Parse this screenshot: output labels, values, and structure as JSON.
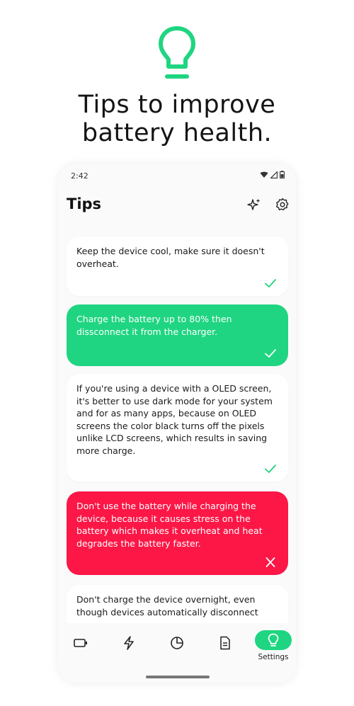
{
  "hero": {
    "icon": "lightbulb-icon",
    "headline_line1": "Tips to improve",
    "headline_line2": "battery health.",
    "accent": "#1fd581"
  },
  "status_bar": {
    "time": "2:42",
    "icons": [
      "wifi-icon",
      "signal-icon",
      "battery-icon"
    ]
  },
  "app_bar": {
    "title": "Tips",
    "actions": [
      "sparkle-icon",
      "settings-icon"
    ]
  },
  "tips": [
    {
      "text": "Keep the device cool, make sure it doesn't overheat.",
      "style": "plain",
      "mark": "check"
    },
    {
      "text": "Charge the battery up to 80% then dissconnect it from the charger.",
      "style": "green",
      "mark": "check"
    },
    {
      "text": "If you're using a device with a  OLED screen, it's better to use dark mode for your system and for as many apps, because on OLED screens the color black turns off the pixels unlike LCD screens, which results in saving more charge.",
      "style": "plain",
      "mark": "check"
    },
    {
      "text": "Don't use the battery while charging the device, because it causes stress on the battery which makes it overheat and heat degrades the battery faster.",
      "style": "red",
      "mark": "cross"
    },
    {
      "text": "Don't charge the device overnight, even though devices automatically disconnect",
      "style": "plain",
      "mark": "none"
    }
  ],
  "nav": {
    "items": [
      "battery-icon",
      "charging-icon",
      "pie-chart-icon",
      "document-icon",
      "lightbulb-icon"
    ],
    "active_label": "Settings"
  },
  "colors": {
    "green": "#1fd581",
    "red": "#fc1747",
    "check": "#1fd581"
  }
}
